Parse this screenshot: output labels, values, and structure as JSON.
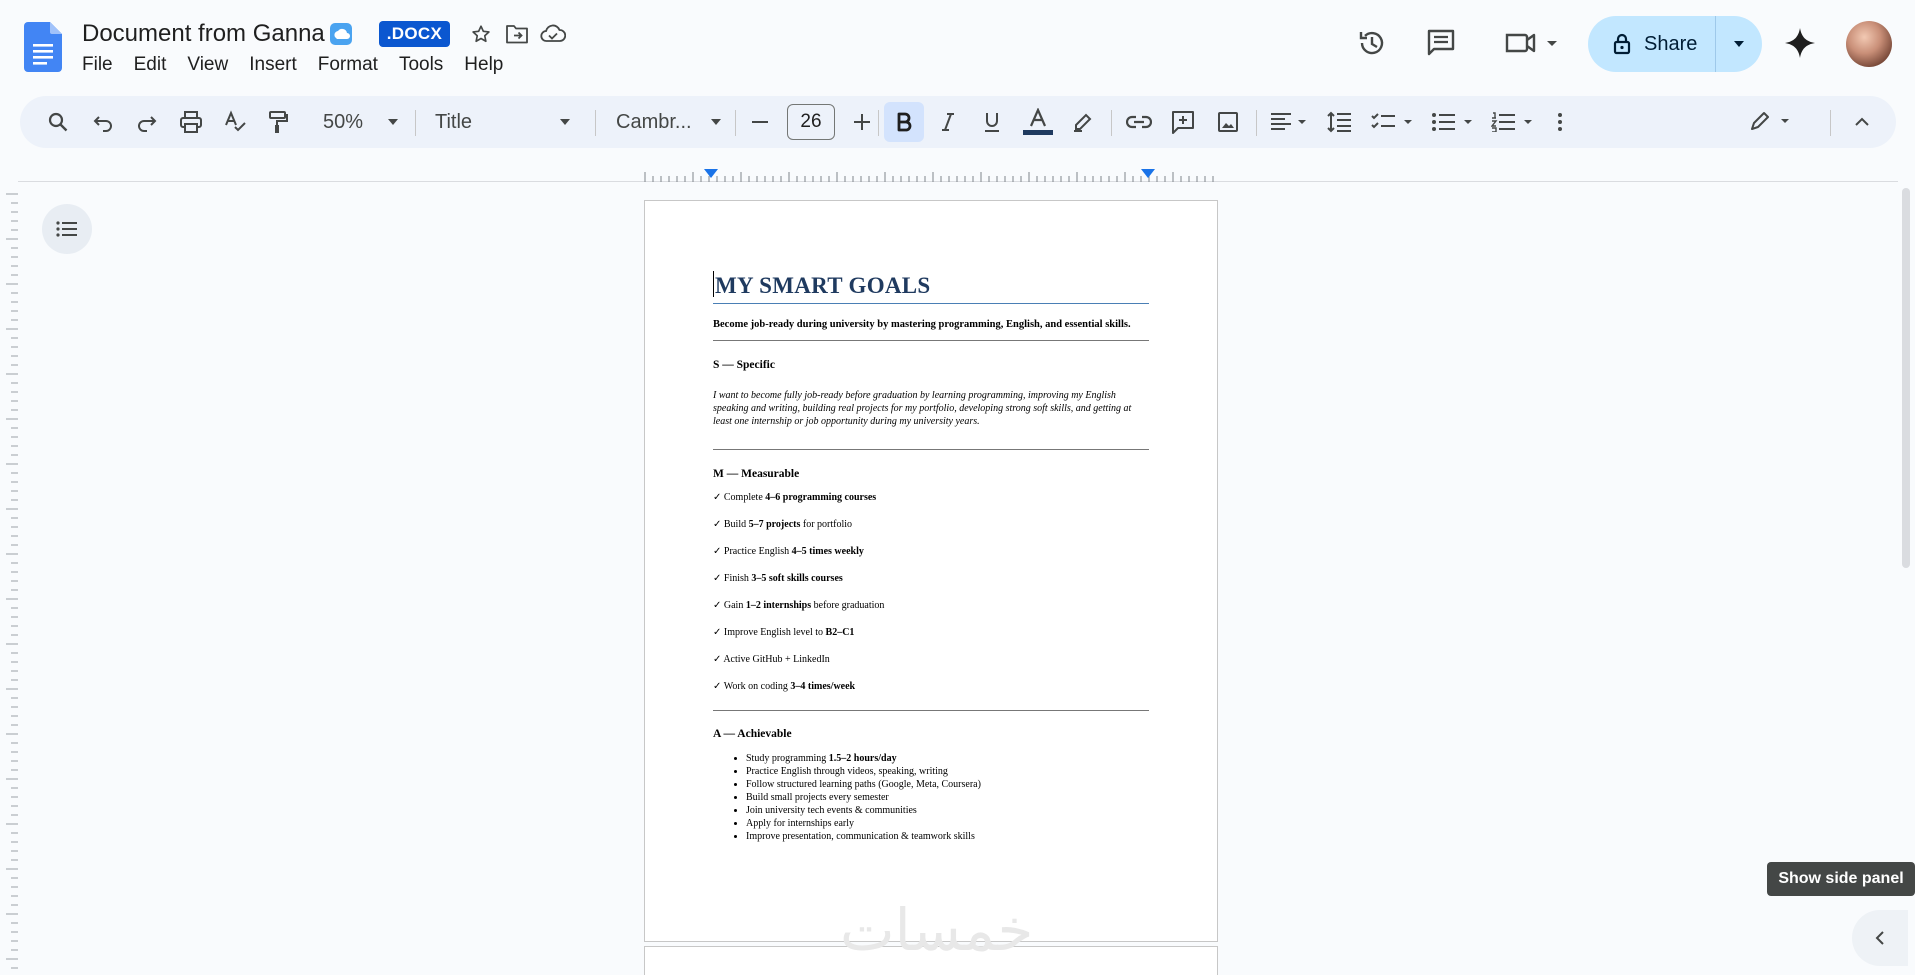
{
  "header": {
    "doc_title": "Document from Ganna",
    "format_badge": ".DOCX",
    "menu": [
      "File",
      "Edit",
      "View",
      "Insert",
      "Format",
      "Tools",
      "Help"
    ],
    "share_label": "Share"
  },
  "toolbar": {
    "zoom": "50%",
    "style": "Title",
    "font": "Cambr...",
    "font_size": "26"
  },
  "document": {
    "title": "MY SMART GOALS",
    "subtitle": "Become job-ready during university by mastering programming, English, and essential skills.",
    "specific": {
      "heading": "S — Specific",
      "text": "I want to become fully job-ready before graduation by learning programming, improving my English speaking and writing, building real projects for my portfolio, developing strong soft skills, and getting at least one internship or job opportunity during my university years."
    },
    "measurable": {
      "heading": "M — Measurable",
      "items": [
        {
          "pre": "✓ Complete ",
          "bold": "4–6 programming courses",
          "post": ""
        },
        {
          "pre": "✓ Build ",
          "bold": "5–7 projects",
          "post": " for portfolio"
        },
        {
          "pre": "✓ Practice English ",
          "bold": "4–5 times weekly",
          "post": ""
        },
        {
          "pre": "✓ Finish ",
          "bold": "3–5 soft skills courses",
          "post": ""
        },
        {
          "pre": "✓ Gain ",
          "bold": "1–2 internships",
          "post": " before graduation"
        },
        {
          "pre": "✓ Improve English level to ",
          "bold": "B2–C1",
          "post": ""
        },
        {
          "pre": "✓ Active GitHub + LinkedIn",
          "bold": "",
          "post": ""
        },
        {
          "pre": "✓ Work on coding ",
          "bold": "3–4 times/week",
          "post": ""
        }
      ]
    },
    "achievable": {
      "heading": "A — Achievable",
      "items": [
        {
          "pre": "Study programming ",
          "bold": "1.5–2 hours/day"
        },
        {
          "pre": "Practice English through videos, speaking, writing",
          "bold": ""
        },
        {
          "pre": "Follow structured learning paths (Google, Meta, Coursera)",
          "bold": ""
        },
        {
          "pre": "Build small projects every semester",
          "bold": ""
        },
        {
          "pre": "Join university tech events & communities",
          "bold": ""
        },
        {
          "pre": "Apply for internships early",
          "bold": ""
        },
        {
          "pre": "Improve presentation, communication & teamwork skills",
          "bold": ""
        }
      ]
    }
  },
  "watermark": "خمسات",
  "tooltip": "Show side panel",
  "icons": [
    "docs-logo-icon",
    "cloud-badge-icon",
    "star-icon",
    "move-folder-icon",
    "cloud-status-icon",
    "history-icon",
    "comments-icon",
    "meet-icon",
    "lock-icon",
    "gemini-icon",
    "search-icon",
    "undo-icon",
    "redo-icon",
    "print-icon",
    "spellcheck-icon",
    "paint-format-icon",
    "outline-icon",
    "chevron-left-icon"
  ],
  "colors": {
    "share_bg": "#c2e7ff",
    "docx_badge": "#0b57d0",
    "toolbar_bg": "#edf2fa",
    "title_text": "#1f3a5f"
  }
}
